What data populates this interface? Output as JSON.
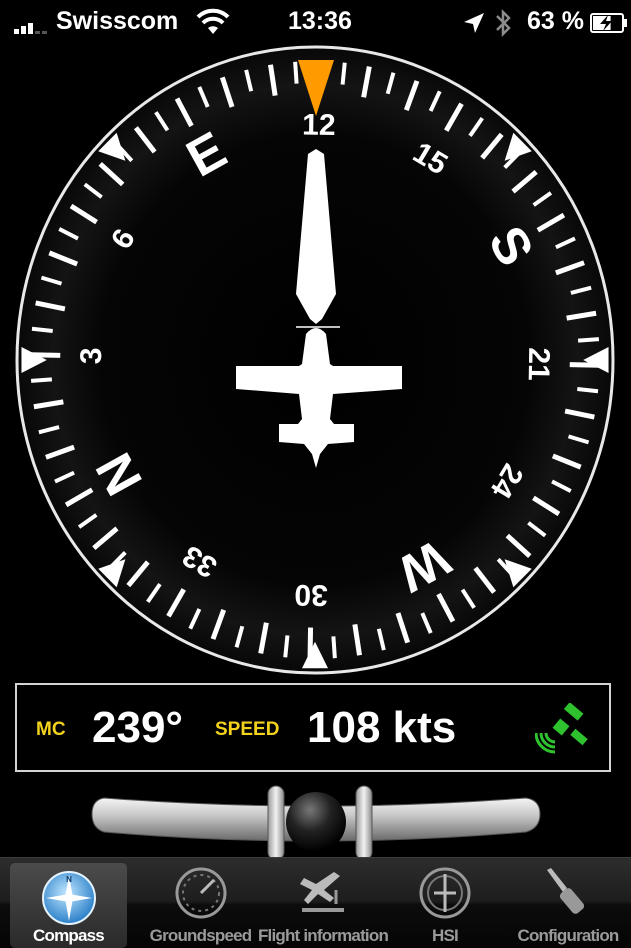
{
  "status_bar": {
    "carrier": "Swisscom",
    "time": "13:36",
    "battery_percent": "63 %",
    "icons": [
      "signal-bars-icon",
      "wifi-icon",
      "location-arrow-icon",
      "bluetooth-icon",
      "battery-charging-icon"
    ],
    "battery_level": 0.63
  },
  "compass": {
    "heading_degrees": 239,
    "card_labels": [
      "24",
      "W",
      "30",
      "33",
      "N",
      "3",
      "6",
      "E",
      "12",
      "15",
      "S",
      "21"
    ],
    "heading_bug_color": "#ff9a00",
    "icons": [
      "airplane-icon",
      "needle-icon",
      "heading-bug-icon"
    ]
  },
  "info": {
    "mc_label": "MC",
    "mc_value": "239°",
    "speed_label": "SPEED",
    "speed_value": "108 kts",
    "gps_icon": "satellite-icon",
    "label_color": "#f3d21e",
    "gps_color": "#2ec22e"
  },
  "tabs": [
    {
      "label": "Compass",
      "icon": "compass-icon",
      "active": true
    },
    {
      "label": "Groundspeed",
      "icon": "speedometer-icon",
      "active": false
    },
    {
      "label": "Flight information",
      "icon": "plane-landing-icon",
      "active": false
    },
    {
      "label": "HSI",
      "icon": "hsi-icon",
      "active": false
    },
    {
      "label": "Configuration",
      "icon": "screwdriver-icon",
      "active": false
    }
  ]
}
